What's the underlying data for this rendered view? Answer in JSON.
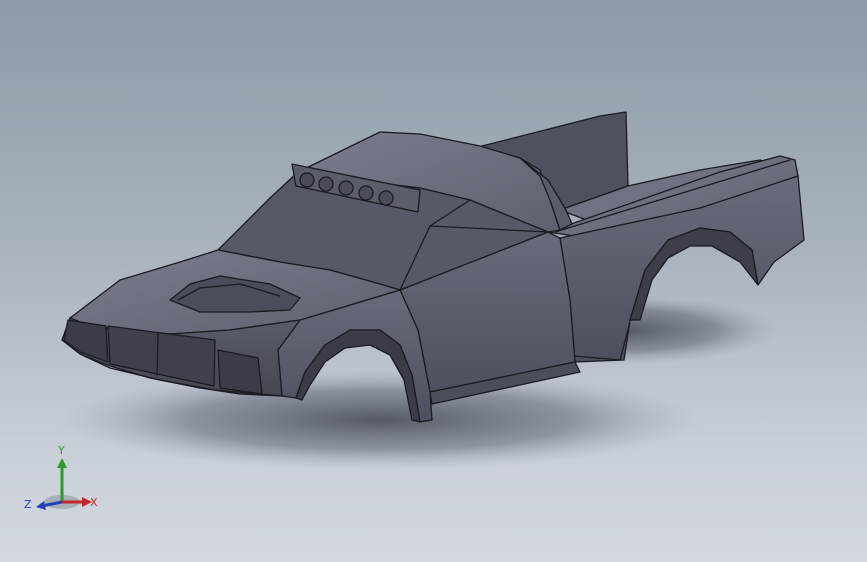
{
  "viewport": {
    "background_top": "#8e9aa8",
    "background_bottom": "#d3d8df"
  },
  "model": {
    "body_color": "#5c5f6e",
    "edge_color": "#1a1b22",
    "shadow_color": "#3a3f4a"
  },
  "triad": {
    "x_label": "X",
    "y_label": "Y",
    "z_label": "Z",
    "x_color": "#c0282a",
    "y_color": "#2e9a2e",
    "z_color": "#2a3fb5"
  }
}
